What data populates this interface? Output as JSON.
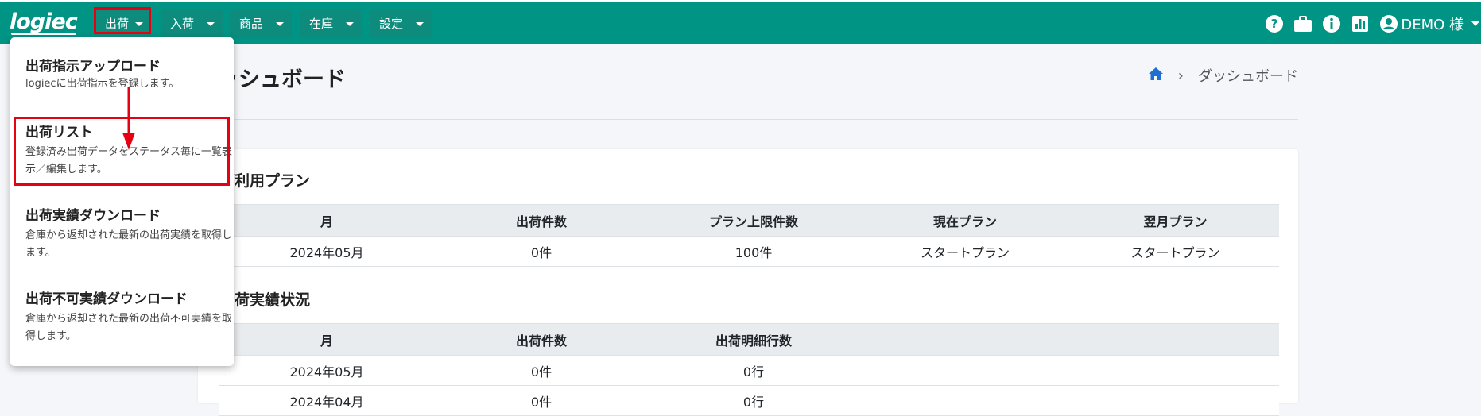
{
  "app": {
    "logo_text": "logiec"
  },
  "nav": {
    "menus": [
      {
        "label": "出荷"
      },
      {
        "label": "入荷"
      },
      {
        "label": "商品"
      },
      {
        "label": "在庫"
      },
      {
        "label": "設定"
      }
    ],
    "user": {
      "name": "DEMO 様"
    },
    "icons": [
      "help-icon",
      "briefcase-icon",
      "info-icon",
      "chart-icon",
      "user-circle-icon"
    ]
  },
  "dropdown": {
    "items": [
      {
        "title": "出荷指示アップロード",
        "desc": "logiecに出荷指示を登録します。"
      },
      {
        "title": "出荷リスト",
        "desc": "登録済み出荷データをステータス毎に一覧表示／編集します。"
      },
      {
        "title": "出荷実績ダウンロード",
        "desc": "倉庫から返却された最新の出荷実績を取得します。"
      },
      {
        "title": "出荷不可実績ダウンロード",
        "desc": "倉庫から返却された最新の出荷不可実績を取得します。"
      }
    ]
  },
  "page": {
    "title": "ダッシュボード",
    "breadcrumb": {
      "current": "ダッシュボード",
      "separator": "›"
    }
  },
  "usage_plan": {
    "title": "ご利用プラン",
    "headers": [
      "月",
      "出荷件数",
      "プラン上限件数",
      "現在プラン",
      "翌月プラン"
    ],
    "rows": [
      [
        "2024年05月",
        "0件",
        "100件",
        "スタートプラン",
        "スタートプラン"
      ]
    ]
  },
  "shipping_status": {
    "title": "出荷実績状況",
    "headers": [
      "月",
      "出荷件数",
      "出荷明細行数",
      "",
      ""
    ],
    "rows": [
      [
        "2024年05月",
        "0件",
        "0行",
        "",
        ""
      ],
      [
        "2024年04月",
        "0件",
        "0行",
        "",
        ""
      ]
    ]
  },
  "colors": {
    "primary": "#009485",
    "highlight": "#e60012"
  }
}
